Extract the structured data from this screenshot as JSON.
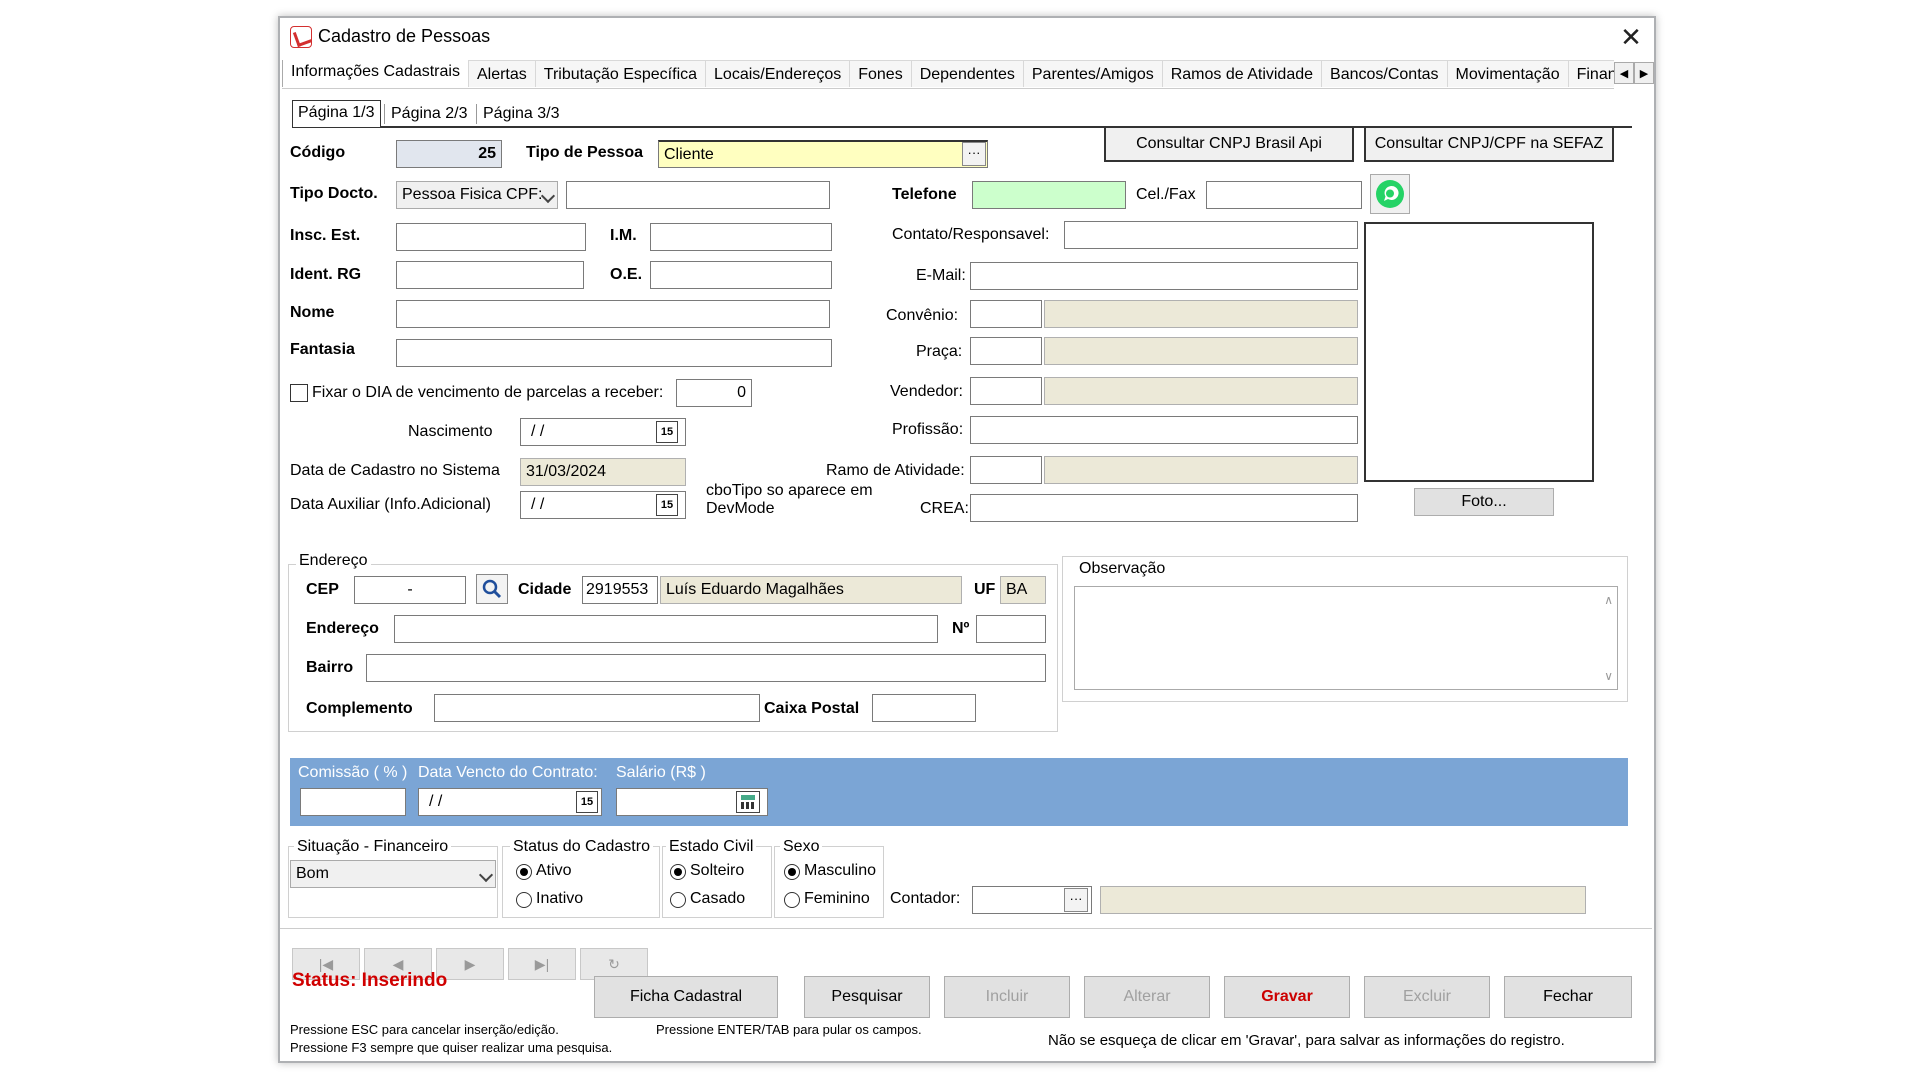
{
  "window": {
    "title": "Cadastro de Pessoas",
    "close": "✕"
  },
  "tabs": [
    "Informações Cadastrais",
    "Alertas",
    "Tributação Específica",
    "Locais/Endereços",
    "Fones",
    "Dependentes",
    "Parentes/Amigos",
    "Ramos de Atividade",
    "Bancos/Contas",
    "Movimentação",
    "Finan"
  ],
  "subtabs": [
    "Página 1/3",
    "Página 2/3",
    "Página 3/3"
  ],
  "buttons_top": {
    "cnpj_api": "Consultar CNPJ Brasil Api",
    "cnpj_sefaz": "Consultar CNPJ/CPF na SEFAZ"
  },
  "form": {
    "codigo_label": "Código",
    "codigo_value": "25",
    "tipo_pessoa_label": "Tipo de Pessoa",
    "tipo_pessoa_value": "Cliente",
    "tipo_docto_label": "Tipo Docto.",
    "tipo_docto_value": "Pessoa Fisica CPF:",
    "insc_est_label": "Insc. Est.",
    "im_label": "I.M.",
    "ident_rg_label": "Ident. RG",
    "oe_label": "O.E.",
    "nome_label": "Nome",
    "fantasia_label": "Fantasia",
    "fixar_label": "Fixar o DIA de vencimento de parcelas a receber:",
    "fixar_value": "0",
    "nascimento_label": "Nascimento",
    "nascimento_value": "/ /",
    "data_cadastro_label": "Data de Cadastro no Sistema",
    "data_cadastro_value": "31/03/2024",
    "data_aux_label": "Data Auxiliar (Info.Adicional)",
    "data_aux_value": "/ /",
    "devmode_note": "cboTipo so aparece em DevMode",
    "telefone_label": "Telefone",
    "celfax_label": "Cel./Fax",
    "contato_label": "Contato/Responsavel:",
    "email_label": "E-Mail:",
    "convenio_label": "Convênio:",
    "praca_label": "Praça:",
    "vendedor_label": "Vendedor:",
    "profissao_label": "Profissão:",
    "ramo_label": "Ramo de Atividade:",
    "crea_label": "CREA:",
    "foto_button": "Foto...",
    "cal_icon": "15"
  },
  "endereco": {
    "group_label": "Endereço",
    "cep_label": "CEP",
    "cep_value": "-",
    "cidade_label": "Cidade",
    "cidade_code": "2919553",
    "cidade_name": "Luís Eduardo Magalhães",
    "uf_label": "UF",
    "uf_value": "BA",
    "endereco_label": "Endereço",
    "numero_label": "Nº",
    "bairro_label": "Bairro",
    "complemento_label": "Complemento",
    "caixa_postal_label": "Caixa Postal"
  },
  "observacao_label": "Observação",
  "blue_panel": {
    "comissao_label": "Comissão ( % )",
    "data_vencto_label": "Data Vencto do Contrato:",
    "data_vencto_value": "/ /",
    "salario_label": "Salário (R$ )"
  },
  "situacao": {
    "label": "Situação - Financeiro",
    "value": "Bom"
  },
  "status_cadastro": {
    "label": "Status do Cadastro",
    "ativo": "Ativo",
    "inativo": "Inativo"
  },
  "estado_civil": {
    "label": "Estado Civil",
    "solteiro": "Solteiro",
    "casado": "Casado"
  },
  "sexo": {
    "label": "Sexo",
    "masculino": "Masculino",
    "feminino": "Feminino"
  },
  "contador_label": "Contador:",
  "nav": [
    "|◀",
    "◀",
    "▶",
    "▶|",
    "↻"
  ],
  "status_text": "Status:  Inserindo",
  "actions": {
    "ficha": "Ficha Cadastral",
    "pesquisar": "Pesquisar",
    "incluir": "Incluir",
    "alterar": "Alterar",
    "gravar": "Gravar",
    "excluir": "Excluir",
    "fechar": "Fechar"
  },
  "hints": {
    "esc": "Pressione ESC para cancelar inserção/edição.",
    "f3": "Pressione F3 sempre que quiser realizar uma pesquisa.",
    "enter": "Pressione ENTER/TAB para pular os campos.",
    "gravar": "Não se esqueça de clicar em 'Gravar', para salvar  as informações do registro."
  },
  "colors": {
    "blue_panel": "#7ba5d5",
    "status_red": "#d00000",
    "whatsapp": "#25d366"
  }
}
